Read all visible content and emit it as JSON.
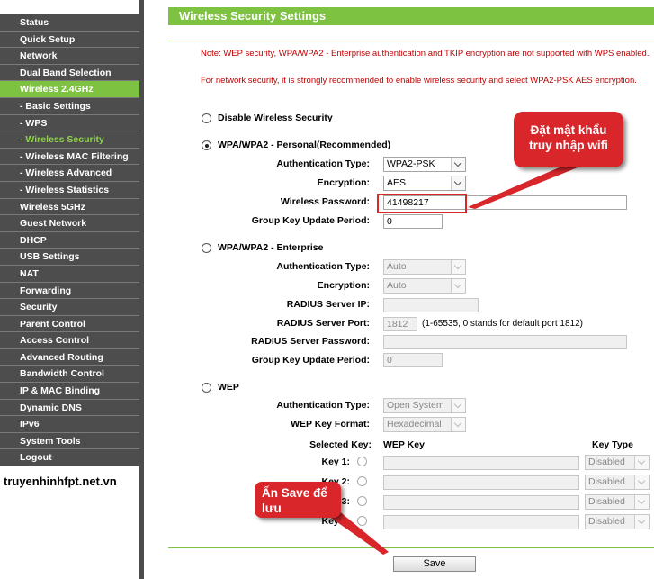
{
  "sidebar": {
    "items": [
      {
        "label": "Status",
        "state": "normal"
      },
      {
        "label": "Quick Setup",
        "state": "normal"
      },
      {
        "label": "Network",
        "state": "normal"
      },
      {
        "label": "Dual Band Selection",
        "state": "normal"
      },
      {
        "label": "Wireless 2.4GHz",
        "state": "active"
      },
      {
        "label": "- Basic Settings",
        "state": "normal"
      },
      {
        "label": "- WPS",
        "state": "normal"
      },
      {
        "label": "- Wireless Security",
        "state": "current"
      },
      {
        "label": "- Wireless MAC Filtering",
        "state": "normal"
      },
      {
        "label": "- Wireless Advanced",
        "state": "normal"
      },
      {
        "label": "- Wireless Statistics",
        "state": "normal"
      },
      {
        "label": "Wireless 5GHz",
        "state": "normal"
      },
      {
        "label": "Guest Network",
        "state": "normal"
      },
      {
        "label": "DHCP",
        "state": "normal"
      },
      {
        "label": "USB Settings",
        "state": "normal"
      },
      {
        "label": "NAT",
        "state": "normal"
      },
      {
        "label": "Forwarding",
        "state": "normal"
      },
      {
        "label": "Security",
        "state": "normal"
      },
      {
        "label": "Parent Control",
        "state": "normal"
      },
      {
        "label": "Access Control",
        "state": "normal"
      },
      {
        "label": "Advanced Routing",
        "state": "normal"
      },
      {
        "label": "Bandwidth Control",
        "state": "normal"
      },
      {
        "label": "IP & MAC Binding",
        "state": "normal"
      },
      {
        "label": "Dynamic DNS",
        "state": "normal"
      },
      {
        "label": "IPv6",
        "state": "normal"
      },
      {
        "label": "System Tools",
        "state": "normal"
      },
      {
        "label": "Logout",
        "state": "normal"
      }
    ],
    "watermark": "truyenhinhfpt.net.vn"
  },
  "page": {
    "title": "Wireless Security Settings",
    "note1": "Note: WEP security, WPA/WPA2 - Enterprise authentication and TKIP encryption are not supported with WPS enabled.",
    "note2": "For network security, it is strongly recommended to enable wireless security and select WPA2-PSK AES encryption."
  },
  "disable": {
    "label": "Disable Wireless Security",
    "checked": false
  },
  "personal": {
    "label": "WPA/WPA2 - Personal(Recommended)",
    "checked": true,
    "auth_label": "Authentication Type:",
    "auth_value": "WPA2-PSK",
    "enc_label": "Encryption:",
    "enc_value": "AES",
    "pw_label": "Wireless Password:",
    "pw_value": "41498217",
    "gk_label": "Group Key Update Period:",
    "gk_value": "0"
  },
  "enterprise": {
    "label": "WPA/WPA2 - Enterprise",
    "checked": false,
    "auth_label": "Authentication Type:",
    "auth_value": "Auto",
    "enc_label": "Encryption:",
    "enc_value": "Auto",
    "ip_label": "RADIUS Server IP:",
    "ip_value": "",
    "port_label": "RADIUS Server Port:",
    "port_value": "1812",
    "port_hint": "(1-65535, 0 stands for default port 1812)",
    "pw_label": "RADIUS Server Password:",
    "pw_value": "",
    "gk_label": "Group Key Update Period:",
    "gk_value": "0"
  },
  "wep": {
    "label": "WEP",
    "checked": false,
    "auth_label": "Authentication Type:",
    "auth_value": "Open System",
    "fmt_label": "WEP Key Format:",
    "fmt_value": "Hexadecimal",
    "col_selected": "Selected Key:",
    "col_key": "WEP Key",
    "col_type": "Key Type",
    "keys": [
      {
        "label": "Key 1:",
        "type": "Disabled"
      },
      {
        "label": "Key 2:",
        "type": "Disabled"
      },
      {
        "label": "Key 3:",
        "type": "Disabled"
      },
      {
        "label": "Key 4:",
        "type": "Disabled"
      }
    ]
  },
  "save_label": "Save",
  "annotations": {
    "password_note": "Đặt mật khẩu truy nhập wifi",
    "save_note": "Ấn Save để lưu",
    "color": "#d8262b"
  },
  "colors": {
    "accent": "#7ec242",
    "menu_bg": "#4d4d4d",
    "note_text": "#c00000"
  }
}
